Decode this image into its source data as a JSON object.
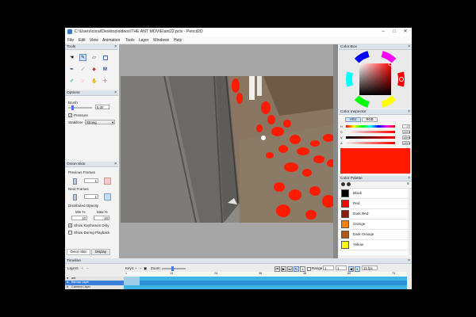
{
  "window": {
    "title": "C:\\Users\\coral\\Desktop\\videos\\THE ANT MOVIE\\ant22.pclx - Pencil2D"
  },
  "menu": [
    "File",
    "Edit",
    "View",
    "Animation",
    "Tools",
    "Layer",
    "Windows",
    "Help"
  ],
  "tools_panel": {
    "title": "Tools",
    "icons": [
      "pointer-icon",
      "pencil-icon",
      "eraser-icon",
      "select-icon",
      "pen-icon",
      "eyedropper-icon",
      "bucket-icon",
      "smudge-icon",
      "brush-icon",
      "hand-icon",
      "polyline-icon",
      "move-icon"
    ]
  },
  "options_panel": {
    "title": "Options",
    "brush_label": "Brush",
    "brush_value": "6.00",
    "pressure_label": "Pressure",
    "stabilizer_label": "Stabilizer",
    "stabilizer_value": "Strong"
  },
  "onion_panel": {
    "title": "Onion Skin",
    "previous_frames_label": "Previous Frames",
    "previous_frames_value": "1",
    "next_frames_label": "Next Frames",
    "next_frames_value": "1",
    "distributed_label": "Distributed Opacity",
    "min_label": "Min %",
    "max_label": "Max %",
    "min_value": "10",
    "max_value": "40",
    "keyframes_only_label": "Show Keyframes Only",
    "during_playback_label": "Show During Playback",
    "tabs": [
      "Onion Skin",
      "Display"
    ]
  },
  "color_box": {
    "title": "Color Box"
  },
  "color_inspector": {
    "title": "Color Inspector",
    "modes": [
      "HSV",
      "RGB"
    ],
    "rows": [
      {
        "label": "H",
        "value": "0°"
      },
      {
        "label": "S",
        "value": "100%"
      },
      {
        "label": "V",
        "value": "100%"
      },
      {
        "label": "A",
        "value": "100%"
      }
    ],
    "current_color": "#ff1a00"
  },
  "color_palette": {
    "title": "Color Palette",
    "colors": [
      {
        "name": "Black",
        "hex": "#000000"
      },
      {
        "name": "Red",
        "hex": "#ff0000"
      },
      {
        "name": "Dark Red",
        "hex": "#8b1a0a"
      },
      {
        "name": "Orange",
        "hex": "#ff8000"
      },
      {
        "name": "Dark Orange",
        "hex": "#b35a10"
      },
      {
        "name": "Yellow",
        "hex": "#ffff00"
      }
    ]
  },
  "timeline": {
    "title": "Timeline",
    "layers_label": "Layers:",
    "keys_label": "Keys:",
    "zoom_label": "Zoom:",
    "range_label": "Range",
    "range_from": "1",
    "range_to": "1",
    "fps_value": "12 fps",
    "frame_numbers": [
      "1",
      "12",
      "24",
      "36",
      "48",
      "60",
      "72"
    ],
    "layers": [
      {
        "name": "ant"
      },
      {
        "name": "Bitmap Layer"
      },
      {
        "name": "Camera Layer"
      }
    ]
  }
}
